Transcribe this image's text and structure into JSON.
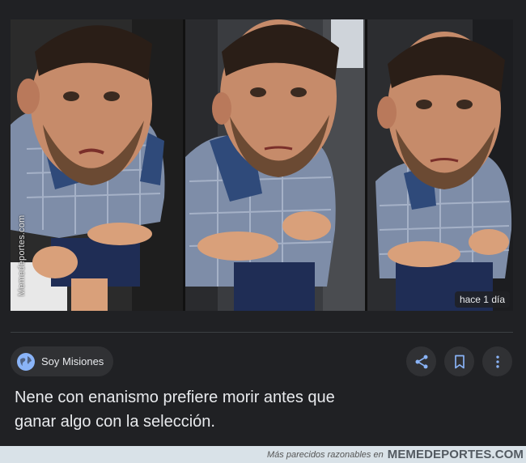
{
  "image": {
    "watermark_vertical": "Memedeportes.com",
    "time_badge": "hace 1 día"
  },
  "source": {
    "name": "Soy Misiones",
    "icon": "globe-icon"
  },
  "actions": [
    {
      "name": "share-icon"
    },
    {
      "name": "bookmark-icon"
    },
    {
      "name": "more-vert-icon"
    }
  ],
  "title": {
    "line1": "Nene con enanismo prefiere morir antes que",
    "line2": "ganar algo con la selección."
  },
  "footer": {
    "small": "Más parecidos razonables en",
    "brand": "MEMEDEPORTES.COM"
  },
  "colors": {
    "background": "#202124",
    "chip": "#303134",
    "text": "#e8eaed",
    "accent": "#8ab4f8"
  }
}
